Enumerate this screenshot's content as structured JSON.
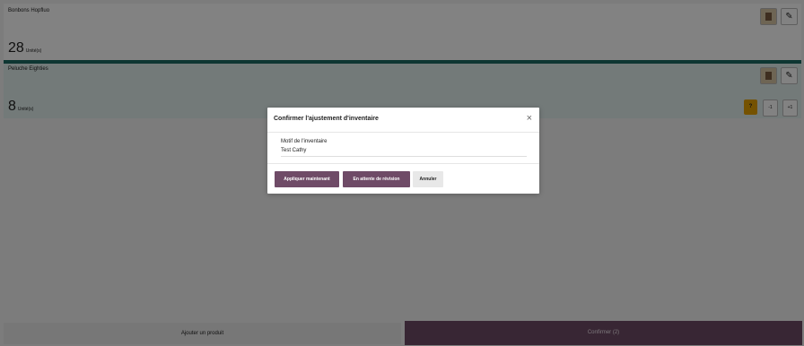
{
  "products": [
    {
      "name": "Bonbons Hopfluo",
      "quantity": "28",
      "unit": "Unité(s)"
    },
    {
      "name": "Peluche Eighties",
      "quantity": "8",
      "unit": "Unité(s)",
      "controls": {
        "question": "?",
        "minus": "-1",
        "plus": "+1"
      }
    }
  ],
  "footer": {
    "add_product": "Ajouter un produit",
    "confirm": "Confirmer (2)"
  },
  "modal": {
    "title": "Confirmer l'ajustement d'inventaire",
    "reason_label": "Motif de l'inventaire",
    "reason_value": "Test Cathy",
    "apply_now": "Appliquer maintenant",
    "pending_review": "En attente de révision",
    "cancel": "Annuler"
  },
  "colors": {
    "primary": "#6f4b67",
    "teal_accent": "#1d6b63",
    "warning": "#e6a100"
  }
}
